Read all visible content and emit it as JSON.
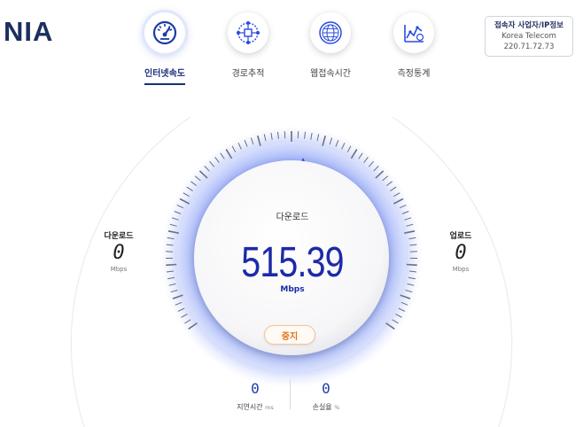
{
  "brand": {
    "logo_text": "NIA"
  },
  "nav": {
    "items": [
      {
        "label": "인터넷속도",
        "icon": "speedometer-icon",
        "active": true
      },
      {
        "label": "경로추적",
        "icon": "route-network-icon",
        "active": false
      },
      {
        "label": "웹접속시간",
        "icon": "globe-icon",
        "active": false
      },
      {
        "label": "측정통계",
        "icon": "statistics-chart-icon",
        "active": false
      }
    ]
  },
  "ip_info": {
    "title": "접속자 사업자/IP정보",
    "isp": "Korea Telecom",
    "ip": "220.71.72.73"
  },
  "download": {
    "label": "다운로드",
    "value": "0",
    "unit": "Mbps"
  },
  "upload": {
    "label": "업로드",
    "value": "0",
    "unit": "Mbps"
  },
  "gauge": {
    "mode_label": "다운로드",
    "speed": "515.39",
    "unit": "Mbps",
    "stop_label": "중지",
    "accent_color": "#2a4ae0",
    "stop_color": "#e0731b"
  },
  "metrics": {
    "latency": {
      "label": "지연시간",
      "unit": "ms",
      "value": "0"
    },
    "loss": {
      "label": "손실율",
      "unit": "%",
      "value": "0"
    }
  }
}
